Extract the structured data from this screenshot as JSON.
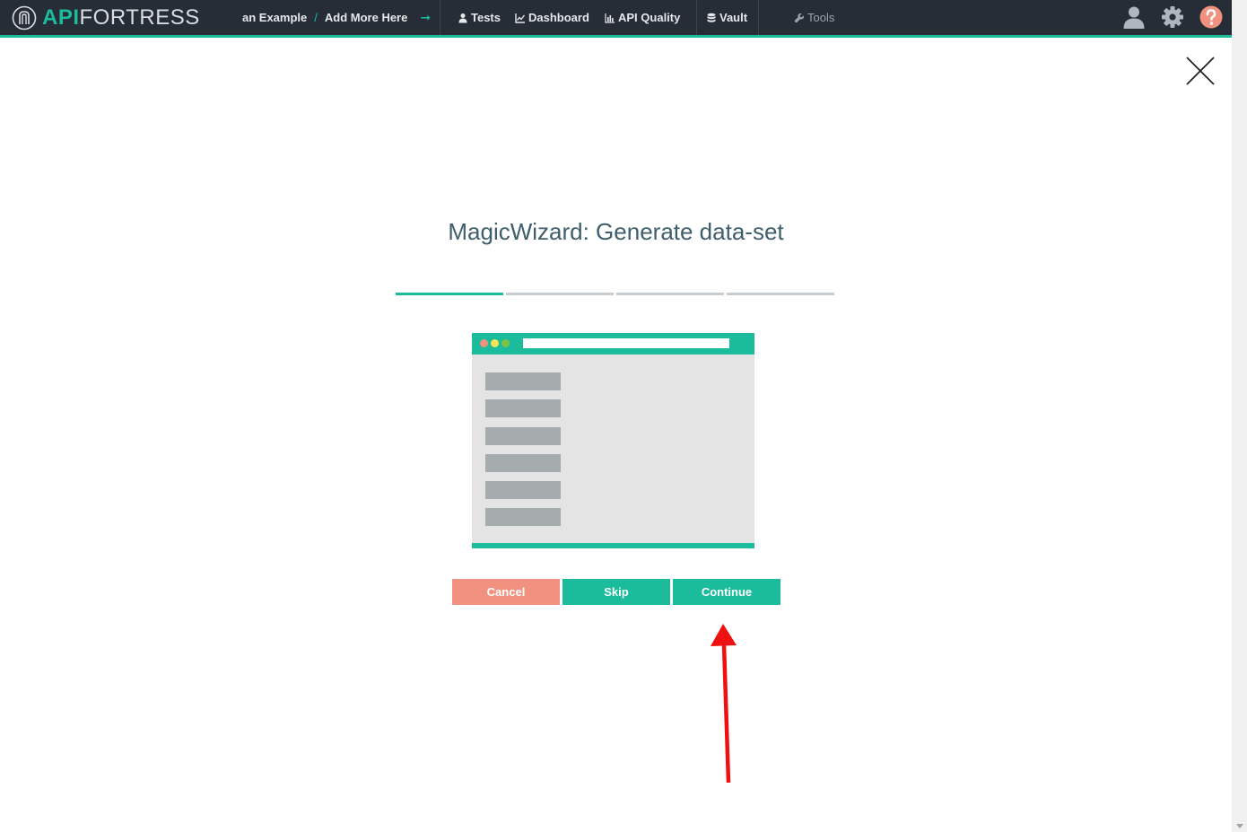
{
  "brand": {
    "api": "API",
    "fortress": "FORTRESS"
  },
  "breadcrumb": {
    "project": "an Example",
    "separator": "/",
    "current": "Add More Here"
  },
  "nav": {
    "tests": "Tests",
    "dashboard": "Dashboard",
    "api_quality": "API Quality",
    "vault": "Vault",
    "tools": "Tools"
  },
  "icons": {
    "user": "user-icon",
    "settings": "gear-icon",
    "help": "help-icon",
    "close": "close-icon"
  },
  "colors": {
    "accent": "#1abc9c",
    "topbar": "#262d37",
    "cancel": "#f1917f",
    "help": "#f1917f",
    "title": "#3f5e6b"
  },
  "wizard": {
    "title": "MagicWizard: Generate data-set",
    "steps_total": 4,
    "current_step": 1,
    "buttons": {
      "cancel": "Cancel",
      "skip": "Skip",
      "continue": "Continue"
    }
  }
}
